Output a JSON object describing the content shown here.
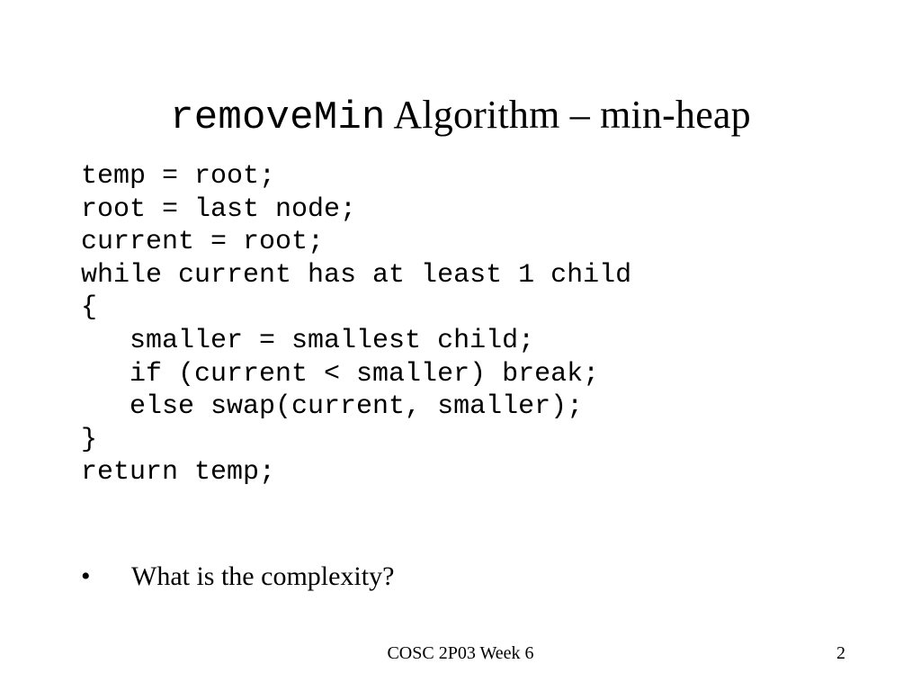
{
  "title": {
    "mono": "removeMin",
    "rest": " Algorithm – min-heap"
  },
  "code": "temp = root;\nroot = last node;\ncurrent = root;\nwhile current has at least 1 child\n{\n   smaller = smallest child;\n   if (current < smaller) break;\n   else swap(current, smaller);\n}\nreturn temp;",
  "bullet": {
    "marker": "•",
    "text": "What is the complexity?"
  },
  "footer": {
    "center": "COSC 2P03 Week 6",
    "page": "2"
  }
}
